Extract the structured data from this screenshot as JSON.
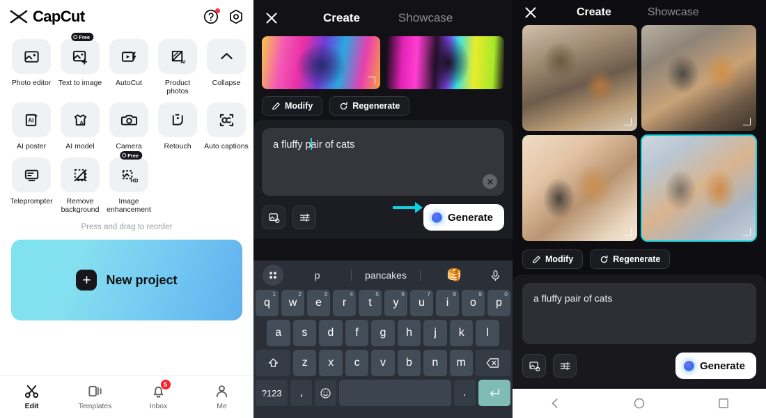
{
  "home": {
    "brand": "CapCut",
    "header_icons": [
      {
        "name": "help-icon",
        "has_dot": true
      },
      {
        "name": "settings-icon",
        "has_dot": false
      }
    ],
    "tools": [
      {
        "label": "Photo editor",
        "icon": "photo-editor-icon",
        "badge": null
      },
      {
        "label": "Text to image",
        "icon": "text-to-image-icon",
        "badge": "Free"
      },
      {
        "label": "AutoCut",
        "icon": "autocut-icon",
        "badge": null
      },
      {
        "label": "Product photos",
        "icon": "product-photos-icon",
        "badge": null
      },
      {
        "label": "Collapse",
        "icon": "chevron-up-icon",
        "badge": null
      },
      {
        "label": "AI poster",
        "icon": "ai-poster-icon",
        "badge": null
      },
      {
        "label": "AI model",
        "icon": "ai-model-icon",
        "badge": null
      },
      {
        "label": "Camera",
        "icon": "camera-icon",
        "badge": null
      },
      {
        "label": "Retouch",
        "icon": "retouch-icon",
        "badge": null
      },
      {
        "label": "Auto captions",
        "icon": "auto-captions-icon",
        "badge": null
      },
      {
        "label": "Teleprompter",
        "icon": "teleprompter-icon",
        "badge": null
      },
      {
        "label": "Remove background",
        "icon": "remove-background-icon",
        "badge": null
      },
      {
        "label": "Image enhancement",
        "icon": "image-enhancement-icon",
        "badge": "Free"
      }
    ],
    "reorder_hint": "Press and drag to reorder",
    "new_project_label": "New project",
    "nav": [
      {
        "label": "Edit",
        "icon": "scissors-icon",
        "badge": null,
        "active": true
      },
      {
        "label": "Templates",
        "icon": "templates-icon",
        "badge": null,
        "active": false
      },
      {
        "label": "Inbox",
        "icon": "bell-icon",
        "badge": "5",
        "active": false
      },
      {
        "label": "Me",
        "icon": "person-icon",
        "badge": null,
        "active": false
      }
    ]
  },
  "create": {
    "tab_create": "Create",
    "tab_showcase": "Showcase",
    "close_icon": "close-icon",
    "thumbnails": [
      {
        "name": "generated-thumb-1",
        "style": "art-a"
      },
      {
        "name": "generated-thumb-2",
        "style": "art-b"
      }
    ],
    "modify_label": "Modify",
    "regenerate_label": "Regenerate",
    "prompt_before_caret": "a fluffy p",
    "prompt_after_caret": "air of cats",
    "prompt_full": "a fluffy pair of cats",
    "generate_label": "Generate",
    "keyboard": {
      "suggestions": [
        "p",
        "pancakes"
      ],
      "emoji_suggestion": "🥞",
      "row1": [
        {
          "k": "q",
          "n": "1"
        },
        {
          "k": "w",
          "n": "2"
        },
        {
          "k": "e",
          "n": "3"
        },
        {
          "k": "r",
          "n": "4"
        },
        {
          "k": "t",
          "n": "5"
        },
        {
          "k": "y",
          "n": "6"
        },
        {
          "k": "u",
          "n": "7"
        },
        {
          "k": "i",
          "n": "8"
        },
        {
          "k": "o",
          "n": "9"
        },
        {
          "k": "p",
          "n": "0"
        }
      ],
      "row2": [
        "a",
        "s",
        "d",
        "f",
        "g",
        "h",
        "j",
        "k",
        "l"
      ],
      "row3": [
        "z",
        "x",
        "c",
        "v",
        "b",
        "n",
        "m"
      ],
      "numeric_key": "?123",
      "comma_key": ",",
      "period_key": ".",
      "space_key": "",
      "shift_icon": "shift-icon",
      "backspace_icon": "backspace-icon",
      "emoji_icon": "emoji-icon",
      "enter_icon": "enter-icon"
    }
  },
  "results": {
    "tab_create": "Create",
    "tab_showcase": "Showcase",
    "close_icon": "close-icon",
    "images": [
      {
        "name": "result-image-1",
        "style": "cat-1",
        "selected": false
      },
      {
        "name": "result-image-2",
        "style": "cat-2",
        "selected": false
      },
      {
        "name": "result-image-3",
        "style": "cat-3",
        "selected": false
      },
      {
        "name": "result-image-4",
        "style": "cat-4",
        "selected": true
      }
    ],
    "modify_label": "Modify",
    "regenerate_label": "Regenerate",
    "prompt_text": "a fluffy pair of cats",
    "generate_label": "Generate",
    "android_nav": [
      "back-icon",
      "home-icon",
      "recents-icon"
    ]
  },
  "colors": {
    "accent_cyan": "#16d5e0",
    "badge_red": "#f5222d",
    "enter_key": "#7fbdb4",
    "keyboard_bg": "#2b3038"
  }
}
